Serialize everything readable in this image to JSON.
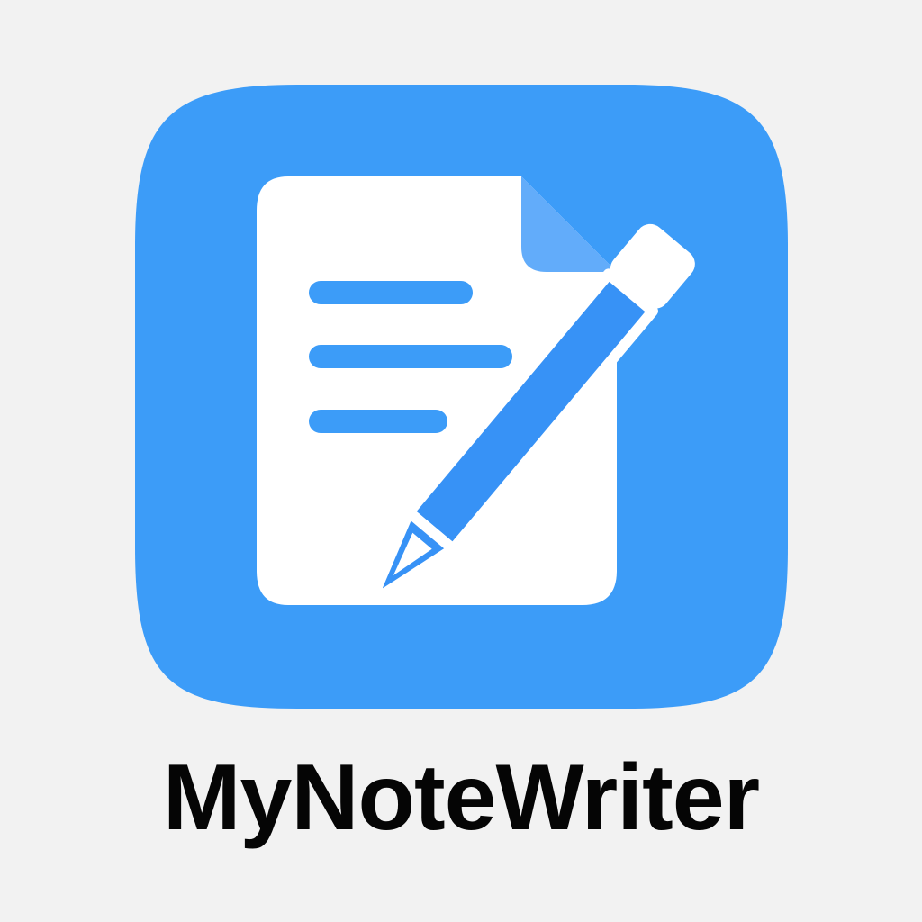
{
  "app": {
    "name": "MyNoteWriter",
    "icon": "note-with-pencil-icon"
  },
  "colors": {
    "background": "#f2f2f2",
    "icon_blue": "#3c9cf8",
    "page_white": "#ffffff",
    "fold_blue": "#62acfa",
    "pencil_blue": "#3792f6",
    "text": "#050505"
  }
}
